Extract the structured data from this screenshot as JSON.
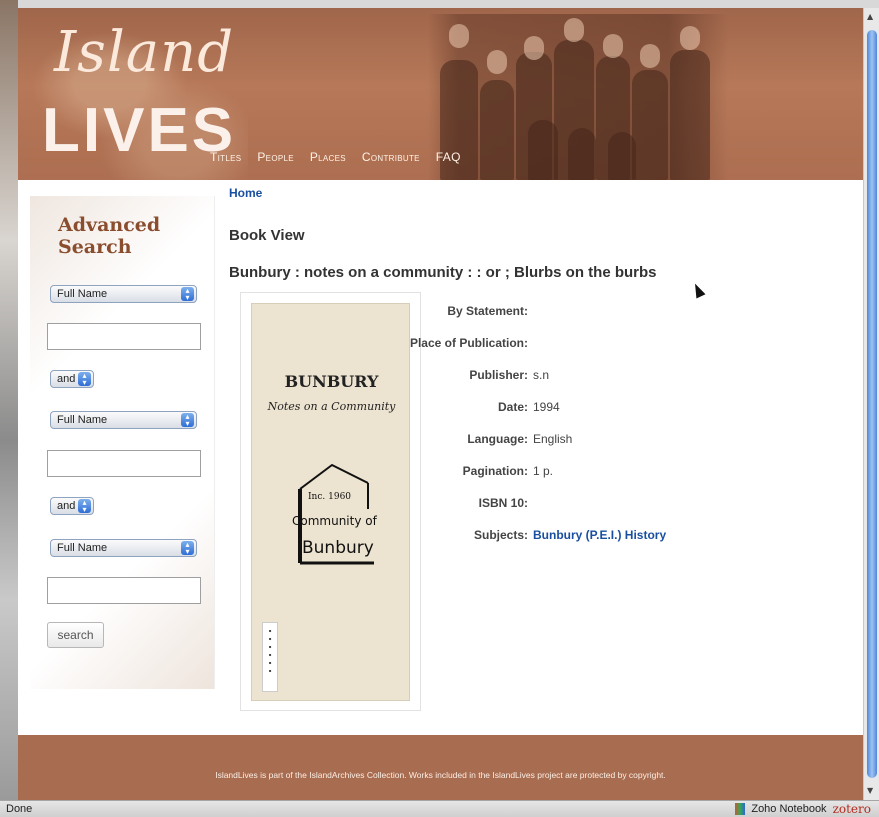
{
  "header": {
    "logo_line1": "Island",
    "logo_line2": "LIVES",
    "nav": [
      "Titles",
      "People",
      "Places",
      "Contribute",
      "FAQ"
    ]
  },
  "sidebar": {
    "title": "Advanced Search",
    "field1_select": "Full Name",
    "operator1": "and",
    "field2_select": "Full Name",
    "operator2": "and",
    "field3_select": "Full Name",
    "search_label": "search"
  },
  "main": {
    "breadcrumb": "Home",
    "heading": "Book View",
    "book_title": "Bunbury : notes on a community : : or ; Blurbs on the burbs",
    "cover": {
      "title": "BUNBURY",
      "subtitle": "Notes on a Community",
      "logo_inc": "Inc. 1960",
      "logo_line1": "Community of",
      "logo_line2": "Bunbury"
    },
    "metadata": [
      {
        "label": "By Statement:",
        "value": ""
      },
      {
        "label": "Place of Publication:",
        "value": ""
      },
      {
        "label": "Publisher:",
        "value": "s.n"
      },
      {
        "label": "Date:",
        "value": "1994"
      },
      {
        "label": "Language:",
        "value": "English"
      },
      {
        "label": "Pagination:",
        "value": "1 p."
      },
      {
        "label": "ISBN 10:",
        "value": ""
      },
      {
        "label": "Subjects:",
        "value": "Bunbury (P.E.I.) History"
      }
    ]
  },
  "footer": {
    "text": "IslandLives is part of the IslandArchives Collection.  Works included in the IslandLives project are protected by copyright."
  },
  "statusbar": {
    "status": "Done",
    "zoho": "Zoho Notebook",
    "zotero": "zotero"
  },
  "colors": {
    "header_bg": "#ad6e51",
    "footer_bg": "#a86c51",
    "link": "#1a4fa0",
    "sidebar_title": "#8a4e2f"
  }
}
